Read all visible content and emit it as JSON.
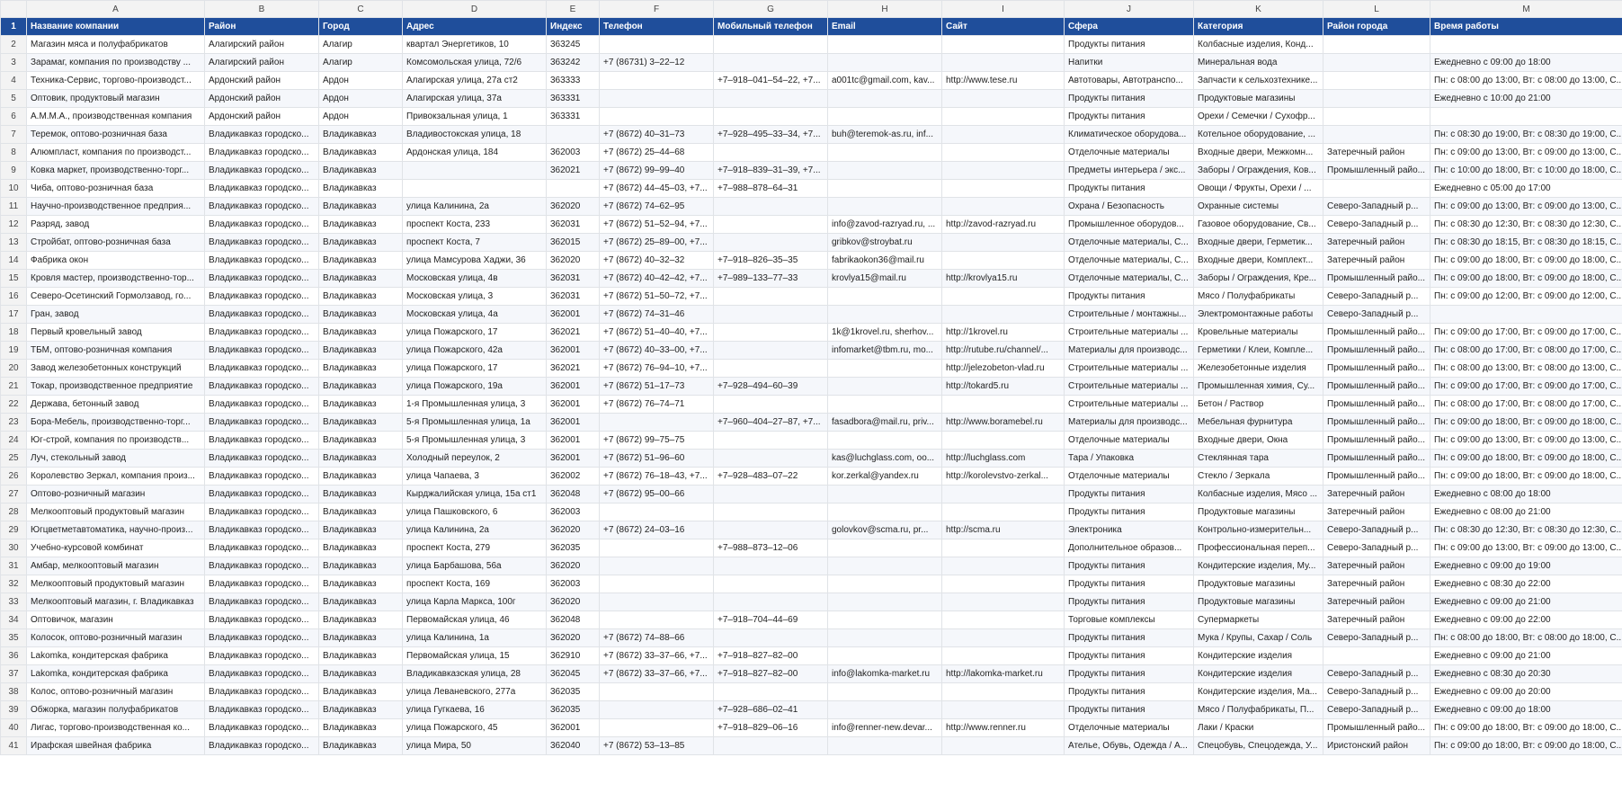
{
  "columns": [
    "A",
    "B",
    "C",
    "D",
    "E",
    "F",
    "G",
    "H",
    "I",
    "J",
    "K",
    "L",
    "M"
  ],
  "header_row_number": "1",
  "headers": [
    "Название компании",
    "Район",
    "Город",
    "Адрес",
    "Индекс",
    "Телефон",
    "Мобильный телефон",
    "Email",
    "Сайт",
    "Сфера",
    "Категория",
    "Район города",
    "Время работы"
  ],
  "rows": [
    [
      "2",
      "Магазин мяса и полуфабрикатов",
      "Алагирский район",
      "Алагир",
      "квартал Энергетиков, 10",
      "363245",
      "",
      "",
      "",
      "",
      "Продукты питания",
      "Колбасные изделия, Конд...",
      "",
      ""
    ],
    [
      "3",
      "Зарамаг, компания по производству ...",
      "Алагирский район",
      "Алагир",
      "Комсомольская улица, 72/6",
      "363242",
      "+7 (86731) 3–22–12",
      "",
      "",
      "",
      "Напитки",
      "Минеральная вода",
      "",
      "Ежедневно с 09:00 до 18:00"
    ],
    [
      "4",
      "Техника-Сервис, торгово-производст...",
      "Ардонский район",
      "Ардон",
      "Алагирская улица, 27а ст2",
      "363333",
      "",
      "+7–918–041–54–22, +7...",
      "a001tc@gmail.com, kav...",
      "http://www.tese.ru",
      "Автотовары, Автотранспо...",
      "Запчасти к сельхозтехнике...",
      "",
      "Пн: с 08:00 до 13:00, Вт: с 08:00 до 13:00, С..."
    ],
    [
      "5",
      "Оптовик, продуктовый магазин",
      "Ардонский район",
      "Ардон",
      "Алагирская улица, 37а",
      "363331",
      "",
      "",
      "",
      "",
      "Продукты питания",
      "Продуктовые магазины",
      "",
      "Ежедневно с 10:00 до 21:00"
    ],
    [
      "6",
      "А.М.М.А., производственная компания",
      "Ардонский район",
      "Ардон",
      "Привокзальная улица, 1",
      "363331",
      "",
      "",
      "",
      "",
      "Продукты питания",
      "Орехи / Семечки / Сухофр...",
      "",
      ""
    ],
    [
      "7",
      "Теремок, оптово-розничная база",
      "Владикавказ городско...",
      "Владикавказ",
      "Владивостокская улица, 18",
      "",
      "+7 (8672) 40–31–73",
      "+7–928–495–33–34, +7...",
      "buh@teremok-as.ru, inf...",
      "",
      "Климатическое оборудова...",
      "Котельное оборудование, ...",
      "",
      "Пн: с 08:30 до 19:00, Вт: с 08:30 до 19:00, С..."
    ],
    [
      "8",
      "Алюмпласт, компания по производст...",
      "Владикавказ городско...",
      "Владикавказ",
      "Ардонская улица, 184",
      "362003",
      "+7 (8672) 25–44–68",
      "",
      "",
      "",
      "Отделочные материалы",
      "Входные двери, Межкомн...",
      "Затеречный район",
      "Пн: с 09:00 до 13:00, Вт: с 09:00 до 13:00, С..."
    ],
    [
      "9",
      "Ковка маркет, производственно-торг...",
      "Владикавказ городско...",
      "Владикавказ",
      "",
      "362021",
      "+7 (8672) 99–99–40",
      "+7–918–839–31–39, +7...",
      "",
      "",
      "Предметы интерьера / экс...",
      "Заборы / Ограждения, Ков...",
      "Промышленный райо...",
      "Пн: с 10:00 до 18:00, Вт: с 10:00 до 18:00, С..."
    ],
    [
      "10",
      "Чиба, оптово-розничная база",
      "Владикавказ городско...",
      "Владикавказ",
      "",
      "",
      "+7 (8672) 44–45–03, +7...",
      "+7–988–878–64–31",
      "",
      "",
      "Продукты питания",
      "Овощи / Фрукты, Орехи / ...",
      "",
      "Ежедневно с 05:00 до 17:00"
    ],
    [
      "11",
      "Научно-производственное предприя...",
      "Владикавказ городско...",
      "Владикавказ",
      "улица Калинина, 2а",
      "362020",
      "+7 (8672) 74–62–95",
      "",
      "",
      "",
      "Охрана / Безопасность",
      "Охранные системы",
      "Северо-Западный р...",
      "Пн: с 09:00 до 13:00, Вт: с 09:00 до 13:00, С..."
    ],
    [
      "12",
      "Разряд, завод",
      "Владикавказ городско...",
      "Владикавказ",
      "проспект Коста, 233",
      "362031",
      "+7 (8672) 51–52–94, +7...",
      "",
      "info@zavod-razryad.ru, ...",
      "http://zavod-razryad.ru",
      "Промышленное оборудов...",
      "Газовое оборудование, Св...",
      "Северо-Западный р...",
      "Пн: с 08:30 до 12:30, Вт: с 08:30 до 12:30, С..."
    ],
    [
      "13",
      "Стройбат, оптово-розничная база",
      "Владикавказ городско...",
      "Владикавказ",
      "проспект Коста, 7",
      "362015",
      "+7 (8672) 25–89–00, +7...",
      "",
      "gribkov@stroybat.ru",
      "",
      "Отделочные материалы, С...",
      "Входные двери, Герметик...",
      "Затеречный район",
      "Пн: с 08:30 до 18:15, Вт: с 08:30 до 18:15, С..."
    ],
    [
      "14",
      "Фабрика окон",
      "Владикавказ городско...",
      "Владикавказ",
      "улица Мамсурова Хаджи, 36",
      "362020",
      "+7 (8672) 40–32–32",
      "+7–918–826–35–35",
      "fabrikaokon36@mail.ru",
      "",
      "Отделочные материалы, С...",
      "Входные двери, Комплект...",
      "Затеречный район",
      "Пн: с 09:00 до 18:00, Вт: с 09:00 до 18:00, С..."
    ],
    [
      "15",
      "Кровля мастер, производственно-тор...",
      "Владикавказ городско...",
      "Владикавказ",
      "Московская улица, 4в",
      "362031",
      "+7 (8672) 40–42–42, +7...",
      "+7–989–133–77–33",
      "krovlya15@mail.ru",
      "http://krovlya15.ru",
      "Отделочные материалы, С...",
      "Заборы / Ограждения, Кре...",
      "Промышленный райо...",
      "Пн: с 09:00 до 18:00, Вт: с 09:00 до 18:00, С..."
    ],
    [
      "16",
      "Северо-Осетинский Гормолзавод, го...",
      "Владикавказ городско...",
      "Владикавказ",
      "Московская улица, 3",
      "362031",
      "+7 (8672) 51–50–72, +7...",
      "",
      "",
      "",
      "Продукты питания",
      "Мясо / Полуфабрикаты",
      "Северо-Западный р...",
      "Пн: с 09:00 до 12:00, Вт: с 09:00 до 12:00, С..."
    ],
    [
      "17",
      "Гран, завод",
      "Владикавказ городско...",
      "Владикавказ",
      "Московская улица, 4а",
      "362001",
      "+7 (8672) 74–31–46",
      "",
      "",
      "",
      "Строительные / монтажны...",
      "Электромонтажные работы",
      "Северо-Западный р...",
      ""
    ],
    [
      "18",
      "Первый кровельный завод",
      "Владикавказ городско...",
      "Владикавказ",
      "улица Пожарского, 17",
      "362021",
      "+7 (8672) 51–40–40, +7...",
      "",
      "1k@1krovel.ru, sherhov...",
      "http://1krovel.ru",
      "Строительные материалы ...",
      "Кровельные материалы",
      "Промышленный райо...",
      "Пн: с 09:00 до 17:00, Вт: с 09:00 до 17:00, С..."
    ],
    [
      "19",
      "ТБМ, оптово-розничная компания",
      "Владикавказ городско...",
      "Владикавказ",
      "улица Пожарского, 42а",
      "362001",
      "+7 (8672) 40–33–00, +7...",
      "",
      "infomarket@tbm.ru, mo...",
      "http://rutube.ru/channel/...",
      "Материалы для производс...",
      "Герметики / Клеи, Компле...",
      "Промышленный райо...",
      "Пн: с 08:00 до 17:00, Вт: с 08:00 до 17:00, С..."
    ],
    [
      "20",
      "Завод железобетонных конструкций",
      "Владикавказ городско...",
      "Владикавказ",
      "улица Пожарского, 17",
      "362021",
      "+7 (8672) 76–94–10, +7...",
      "",
      "",
      "http://jelezobeton-vlad.ru",
      "Строительные материалы ...",
      "Железобетонные изделия",
      "Промышленный райо...",
      "Пн: с 08:00 до 13:00, Вт: с 08:00 до 13:00, С..."
    ],
    [
      "21",
      "Токар, производственное предприятие",
      "Владикавказ городско...",
      "Владикавказ",
      "улица Пожарского, 19а",
      "362001",
      "+7 (8672) 51–17–73",
      "+7–928–494–60–39",
      "",
      "http://tokard5.ru",
      "Строительные материалы ...",
      "Промышленная химия, Су...",
      "Промышленный райо...",
      "Пн: с 09:00 до 17:00, Вт: с 09:00 до 17:00, С..."
    ],
    [
      "22",
      "Держава, бетонный завод",
      "Владикавказ городско...",
      "Владикавказ",
      "1-я Промышленная улица, 3",
      "362001",
      "+7 (8672) 76–74–71",
      "",
      "",
      "",
      "Строительные материалы ...",
      "Бетон / Раствор",
      "Промышленный райо...",
      "Пн: с 08:00 до 17:00, Вт: с 08:00 до 17:00, С..."
    ],
    [
      "23",
      "Бора-Мебель, производственно-торг...",
      "Владикавказ городско...",
      "Владикавказ",
      "5-я Промышленная улица, 1а",
      "362001",
      "",
      "+7–960–404–27–87, +7...",
      "fasadbora@mail.ru, priv...",
      "http://www.boramebel.ru",
      "Материалы для производс...",
      "Мебельная фурнитура",
      "Промышленный райо...",
      "Пн: с 09:00 до 18:00, Вт: с 09:00 до 18:00, С..."
    ],
    [
      "24",
      "Юг-строй, компания по производств...",
      "Владикавказ городско...",
      "Владикавказ",
      "5-я Промышленная улица, 3",
      "362001",
      "+7 (8672) 99–75–75",
      "",
      "",
      "",
      "Отделочные материалы",
      "Входные двери, Окна",
      "Промышленный райо...",
      "Пн: с 09:00 до 13:00, Вт: с 09:00 до 13:00, С..."
    ],
    [
      "25",
      "Луч, стекольный завод",
      "Владикавказ городско...",
      "Владикавказ",
      "Холодный переулок, 2",
      "362001",
      "+7 (8672) 51–96–60",
      "",
      "kas@luchglass.com, oo...",
      "http://luchglass.com",
      "Тара / Упаковка",
      "Стеклянная тара",
      "Промышленный райо...",
      "Пн: с 09:00 до 18:00, Вт: с 09:00 до 18:00, С..."
    ],
    [
      "26",
      "Королевство Зеркал, компания произ...",
      "Владикавказ городско...",
      "Владикавказ",
      "улица Чапаева, 3",
      "362002",
      "+7 (8672) 76–18–43, +7...",
      "+7–928–483–07–22",
      "kor.zerkal@yandex.ru",
      "http://korolevstvo-zerkal...",
      "Отделочные материалы",
      "Стекло / Зеркала",
      "Промышленный райо...",
      "Пн: с 09:00 до 18:00, Вт: с 09:00 до 18:00, С..."
    ],
    [
      "27",
      "Оптово-розничный магазин",
      "Владикавказ городско...",
      "Владикавказ",
      "Кырджалийская улица, 15а ст1",
      "362048",
      "+7 (8672) 95–00–66",
      "",
      "",
      "",
      "Продукты питания",
      "Колбасные изделия, Мясо ...",
      "Затеречный район",
      "Ежедневно с 08:00 до 18:00"
    ],
    [
      "28",
      "Мелкооптовый продуктовый магазин",
      "Владикавказ городско...",
      "Владикавказ",
      "улица Пашковского, 6",
      "362003",
      "",
      "",
      "",
      "",
      "Продукты питания",
      "Продуктовые магазины",
      "Затеречный район",
      "Ежедневно с 08:00 до 21:00"
    ],
    [
      "29",
      "Югцветметавтоматика, научно-произ...",
      "Владикавказ городско...",
      "Владикавказ",
      "улица Калинина, 2а",
      "362020",
      "+7 (8672) 24–03–16",
      "",
      "golovkov@scma.ru, pr...",
      "http://scma.ru",
      "Электроника",
      "Контрольно-измерительн...",
      "Северо-Западный р...",
      "Пн: с 08:30 до 12:30, Вт: с 08:30 до 12:30, С..."
    ],
    [
      "30",
      "Учебно-курсовой комбинат",
      "Владикавказ городско...",
      "Владикавказ",
      "проспект Коста, 279",
      "362035",
      "",
      "+7–988–873–12–06",
      "",
      "",
      "Дополнительное образов...",
      "Профессиональная переп...",
      "Северо-Западный р...",
      "Пн: с 09:00 до 13:00, Вт: с 09:00 до 13:00, С..."
    ],
    [
      "31",
      "Амбар, мелкооптовый магазин",
      "Владикавказ городско...",
      "Владикавказ",
      "улица Барбашова, 56а",
      "362020",
      "",
      "",
      "",
      "",
      "Продукты питания",
      "Кондитерские изделия, Му...",
      "Затеречный район",
      "Ежедневно с 09:00 до 19:00"
    ],
    [
      "32",
      "Мелкооптовый продуктовый магазин",
      "Владикавказ городско...",
      "Владикавказ",
      "проспект Коста, 169",
      "362003",
      "",
      "",
      "",
      "",
      "Продукты питания",
      "Продуктовые магазины",
      "Затеречный район",
      "Ежедневно с 08:30 до 22:00"
    ],
    [
      "33",
      "Мелкооптовый магазин, г. Владикавказ",
      "Владикавказ городско...",
      "Владикавказ",
      "улица Карла Маркса, 100г",
      "362020",
      "",
      "",
      "",
      "",
      "Продукты питания",
      "Продуктовые магазины",
      "Затеречный район",
      "Ежедневно с 09:00 до 21:00"
    ],
    [
      "34",
      "Оптовичок, магазин",
      "Владикавказ городско...",
      "Владикавказ",
      "Первомайская улица, 46",
      "362048",
      "",
      "+7–918–704–44–69",
      "",
      "",
      "Торговые комплексы",
      "Супермаркеты",
      "Затеречный район",
      "Ежедневно с 09:00 до 22:00"
    ],
    [
      "35",
      "Колосок, оптово-розничный магазин",
      "Владикавказ городско...",
      "Владикавказ",
      "улица Калинина, 1а",
      "362020",
      "+7 (8672) 74–88–66",
      "",
      "",
      "",
      "Продукты питания",
      "Мука / Крупы, Сахар / Соль",
      "Северо-Западный р...",
      "Пн: с 08:00 до 18:00, Вт: с 08:00 до 18:00, С..."
    ],
    [
      "36",
      "Lakomka, кондитерская фабрика",
      "Владикавказ городско...",
      "Владикавказ",
      "Первомайская улица, 15",
      "362910",
      "+7 (8672) 33–37–66, +7...",
      "+7–918–827–82–00",
      "",
      "",
      "Продукты питания",
      "Кондитерские изделия",
      "",
      "Ежедневно с 09:00 до 21:00"
    ],
    [
      "37",
      "Lakomka, кондитерская фабрика",
      "Владикавказ городско...",
      "Владикавказ",
      "Владикавказская улица, 28",
      "362045",
      "+7 (8672) 33–37–66, +7...",
      "+7–918–827–82–00",
      "info@lakomka-market.ru",
      "http://lakomka-market.ru",
      "Продукты питания",
      "Кондитерские изделия",
      "Северо-Западный р...",
      "Ежедневно с 08:30 до 20:30"
    ],
    [
      "38",
      "Колос, оптово-розничный магазин",
      "Владикавказ городско...",
      "Владикавказ",
      "улица Леваневского, 277а",
      "362035",
      "",
      "",
      "",
      "",
      "Продукты питания",
      "Кондитерские изделия, Ма...",
      "Северо-Западный р...",
      "Ежедневно с 09:00 до 20:00"
    ],
    [
      "39",
      "Обжорка, магазин полуфабрикатов",
      "Владикавказ городско...",
      "Владикавказ",
      "улица Гугкаева, 16",
      "362035",
      "",
      "+7–928–686–02–41",
      "",
      "",
      "Продукты питания",
      "Мясо / Полуфабрикаты, П...",
      "Северо-Западный р...",
      "Ежедневно с 09:00 до 18:00"
    ],
    [
      "40",
      "Лигас, торгово-производственная ко...",
      "Владикавказ городско...",
      "Владикавказ",
      "улица Пожарского, 45",
      "362001",
      "",
      "+7–918–829–06–16",
      "info@renner-new.devar...",
      "http://www.renner.ru",
      "Отделочные материалы",
      "Лаки / Краски",
      "Промышленный райо...",
      "Пн: с 09:00 до 18:00, Вт: с 09:00 до 18:00, С..."
    ],
    [
      "41",
      "Ирафская швейная фабрика",
      "Владикавказ городско...",
      "Владикавказ",
      "улица Мира, 50",
      "362040",
      "+7 (8672) 53–13–85",
      "",
      "",
      "",
      "Ателье, Обувь, Одежда / А...",
      "Спецобувь, Спецодежда, У...",
      "Иристонский район",
      "Пн: с 09:00 до 18:00, Вт: с 09:00 до 18:00, С..."
    ]
  ]
}
